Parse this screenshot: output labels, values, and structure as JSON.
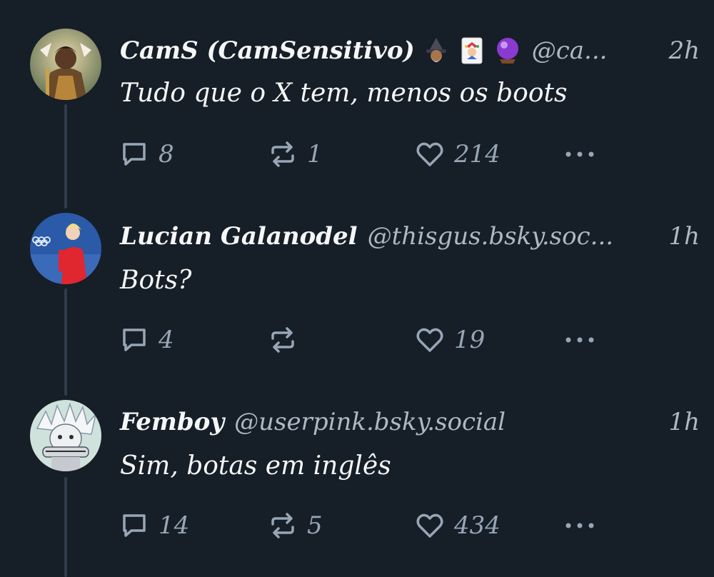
{
  "posts": [
    {
      "display_name": "CamS  (CamSensitivo)",
      "emojis": [
        "mage-emoji",
        "joker-card-emoji",
        "crystal-ball-emoji"
      ],
      "handle": "@ca...",
      "time": "2h",
      "text": "Tudo que o X tem, menos os boots",
      "replies": "8",
      "reposts": "1",
      "likes": "214"
    },
    {
      "display_name": "Lucian Galanodel",
      "handle": "@thisgus.bsky.soc...",
      "time": "1h",
      "text": "Bots?",
      "replies": "4",
      "reposts": "",
      "likes": "19"
    },
    {
      "display_name": "Femboy",
      "handle": "@userpink.bsky.social",
      "time": "1h",
      "text": "Sim, botas em inglês",
      "replies": "14",
      "reposts": "5",
      "likes": "434"
    }
  ],
  "colors": {
    "background": "#161e27",
    "thread_line": "#2e3c4c",
    "muted": "#97a6b6"
  }
}
